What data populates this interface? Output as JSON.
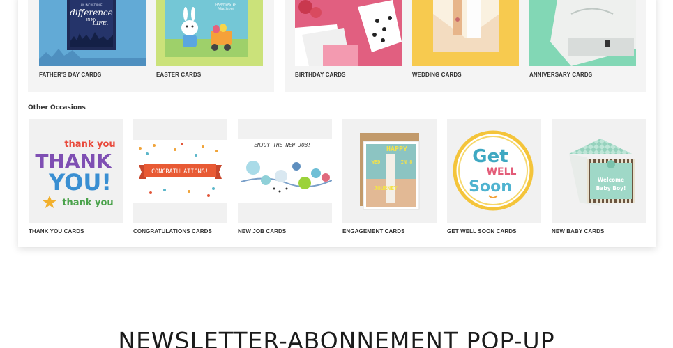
{
  "top_row": [
    {
      "label": "FATHER'S DAY CARDS",
      "card_text": [
        "AN INCREDIBLE",
        "difference",
        "IN MY",
        "LIFE."
      ]
    },
    {
      "label": "EASTER CARDS",
      "card_text": [
        "HAPPY EASTER",
        "Madison!"
      ]
    },
    {
      "label": "BIRTHDAY CARDS",
      "card_text": []
    },
    {
      "label": "WEDDING CARDS",
      "card_text": []
    },
    {
      "label": "ANNIVERSARY CARDS",
      "card_text": []
    }
  ],
  "other_occasions": {
    "title": "Other Occasions",
    "cards": [
      {
        "label": "THANK YOU CARDS",
        "card_text": [
          "thank you",
          "THANK",
          "YOU!",
          "thank you"
        ]
      },
      {
        "label": "CONGRATULATIONS CARDS",
        "card_text": [
          "CONGRATULATIONS!"
        ]
      },
      {
        "label": "NEW JOB CARDS",
        "card_text": [
          "ENJOY THE NEW JOB!"
        ]
      },
      {
        "label": "ENGAGEMENT CARDS",
        "card_text": [
          "HAPPY",
          "WED",
          "IN 8",
          "JOURNEY"
        ]
      },
      {
        "label": "GET WELL SOON CARDS",
        "card_text": [
          "Get",
          "WELL",
          "Soon"
        ]
      },
      {
        "label": "NEW BABY CARDS",
        "card_text": [
          "Welcome",
          "Baby Boy!"
        ]
      }
    ]
  },
  "newsletter_heading": "NEWSLETTER-ABONNEMENT POP-UP"
}
